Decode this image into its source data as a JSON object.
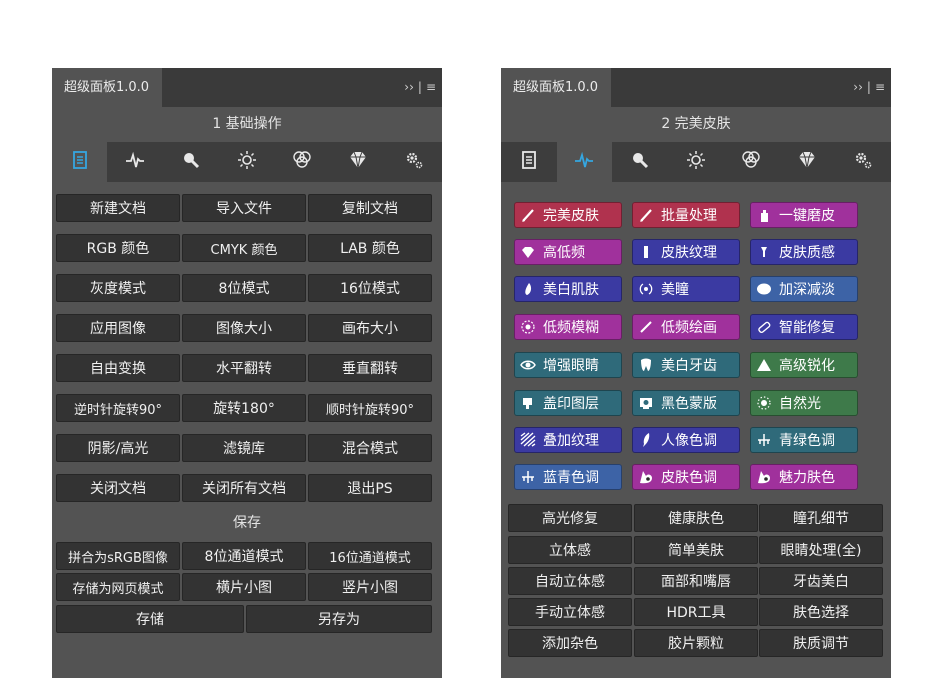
{
  "colors": {
    "red": "#b0324e",
    "magenta": "#a0319c",
    "indigo": "#3b3aa2",
    "blue": "#3d63a6",
    "teal": "#2f6a7a",
    "green": "#3e7a4a",
    "panel": "#535353",
    "button": "#333333"
  },
  "left_panel": {
    "tab_label": "超级面板1.0.0",
    "header_icons": {
      "expand": "››",
      "sep": "|",
      "menu": "≡"
    },
    "title": "1 基础操作",
    "tools": [
      "document-icon",
      "pulse-icon",
      "magnifier-icon",
      "sun-icon",
      "rgb-circles-icon",
      "diamond-icon",
      "gear-icon"
    ],
    "rows": [
      [
        "新建文档",
        "导入文件",
        "复制文档"
      ],
      [
        "RGB 颜色",
        "CMYK 颜色",
        "LAB 颜色"
      ],
      [
        "灰度模式",
        "8位模式",
        "16位模式"
      ],
      [
        "应用图像",
        "图像大小",
        "画布大小"
      ],
      [
        "自由变换",
        "水平翻转",
        "垂直翻转"
      ],
      [
        "逆时针旋转90°",
        "旋转180°",
        "顺时针旋转90°"
      ],
      [
        "阴影/高光",
        "滤镜库",
        "混合模式"
      ],
      [
        "关闭文档",
        "关闭所有文档",
        "退出PS"
      ]
    ],
    "save_label": "保存",
    "save_rows": [
      [
        "拼合为sRGB图像",
        "8位通道模式",
        "16位通道模式"
      ],
      [
        "存储为网页模式",
        "横片小图",
        "竖片小图"
      ]
    ],
    "last_row": [
      "存储",
      "另存为"
    ]
  },
  "right_panel": {
    "tab_label": "超级面板1.0.0",
    "header_icons": {
      "expand": "››",
      "sep": "|",
      "menu": "≡"
    },
    "title": "2 完美皮肤",
    "tools": [
      "document-icon",
      "pulse-icon",
      "magnifier-icon",
      "sun-icon",
      "rgb-circles-icon",
      "diamond-icon",
      "gear-icon"
    ],
    "color_rows": [
      [
        {
          "label": "完美皮肤",
          "color": "red",
          "icon": "brush-icon"
        },
        {
          "label": "批量处理",
          "color": "red",
          "icon": "brush-icon"
        },
        {
          "label": "一键磨皮",
          "color": "magenta",
          "icon": "bottle-icon"
        }
      ],
      [
        {
          "label": "高低频",
          "color": "magenta",
          "icon": "gem-icon"
        },
        {
          "label": "皮肤纹理",
          "color": "indigo",
          "icon": "bar-icon"
        },
        {
          "label": "皮肤质感",
          "color": "indigo",
          "icon": "pin-icon"
        }
      ],
      [
        {
          "label": "美白肌肤",
          "color": "indigo",
          "icon": "drop-icon"
        },
        {
          "label": "美瞳",
          "color": "indigo",
          "icon": "dot-ring-icon"
        },
        {
          "label": "加深减淡",
          "color": "blue",
          "icon": "ellipse-icon"
        }
      ],
      [
        {
          "label": "低频模糊",
          "color": "magenta",
          "icon": "target-icon"
        },
        {
          "label": "低频绘画",
          "color": "magenta",
          "icon": "pen-icon"
        },
        {
          "label": "智能修复",
          "color": "indigo",
          "icon": "bandage-icon"
        }
      ],
      [
        {
          "label": "增强眼睛",
          "color": "teal",
          "icon": "eye-icon"
        },
        {
          "label": "美白牙齿",
          "color": "teal",
          "icon": "tooth-icon"
        },
        {
          "label": "高级锐化",
          "color": "green",
          "icon": "triangle-icon"
        }
      ],
      [
        {
          "label": "盖印图层",
          "color": "teal",
          "icon": "stamp-icon"
        },
        {
          "label": "黑色蒙版",
          "color": "teal",
          "icon": "mask-icon"
        },
        {
          "label": "自然光",
          "color": "green",
          "icon": "light-icon"
        }
      ],
      [
        {
          "label": "叠加纹理",
          "color": "indigo",
          "icon": "texture-icon"
        },
        {
          "label": "人像色调",
          "color": "indigo",
          "icon": "feather-icon"
        },
        {
          "label": "青绿色调",
          "color": "teal",
          "icon": "crosshair-icon"
        }
      ],
      [
        {
          "label": "蓝青色调",
          "color": "blue",
          "icon": "crosshair-icon"
        },
        {
          "label": "皮肤色调",
          "color": "magenta",
          "icon": "skin-icon"
        },
        {
          "label": "魅力肤色",
          "color": "magenta",
          "icon": "skin-icon"
        }
      ]
    ],
    "gray_rows": [
      [
        "高光修复",
        "健康肤色",
        "瞳孔细节"
      ],
      [
        "立体感",
        "简单美肤",
        "眼睛处理(全)"
      ],
      [
        "自动立体感",
        "面部和嘴唇",
        "牙齿美白"
      ],
      [
        "手动立体感",
        "HDR工具",
        "肤色选择"
      ],
      [
        "添加杂色",
        "胶片颗粒",
        "肤质调节"
      ]
    ]
  }
}
